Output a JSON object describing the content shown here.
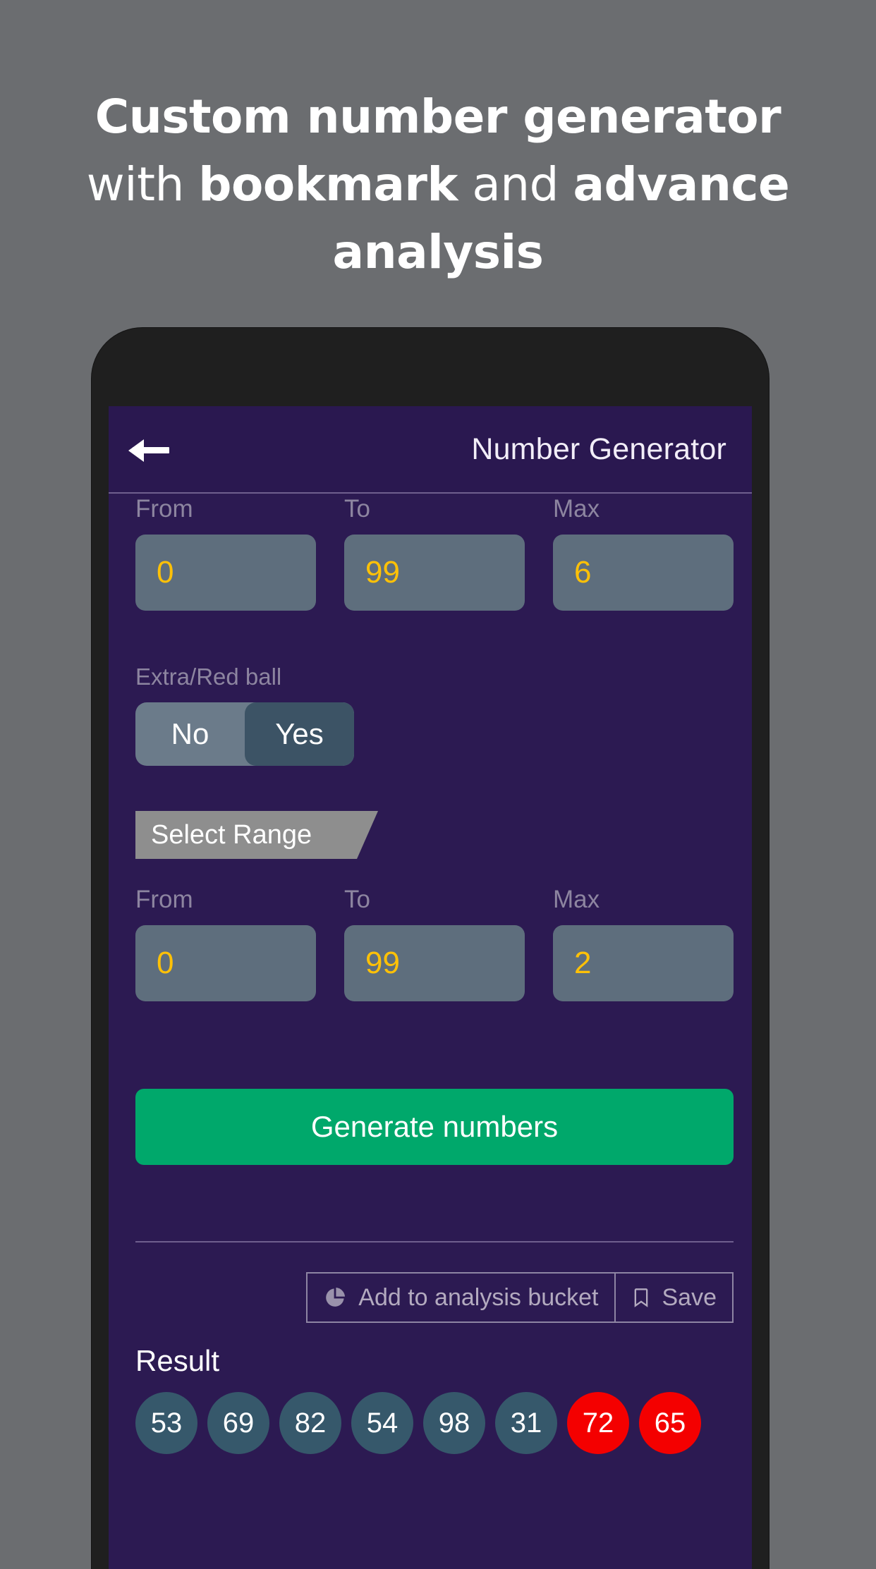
{
  "promo": {
    "line1_bold": "Custom number generator",
    "line2_prefix": "with ",
    "line2_bold1": "bookmark",
    "line2_mid": " and ",
    "line2_bold2": "advance",
    "line3_bold": "analysis"
  },
  "appbar": {
    "back_icon": "back-arrow-icon",
    "title": "Number Generator"
  },
  "primary_range": {
    "from_label": "From",
    "from_value": "0",
    "to_label": "To",
    "to_value": "99",
    "max_label": "Max",
    "max_value": "6"
  },
  "extra_ball": {
    "label": "Extra/Red ball",
    "option_no": "No",
    "option_yes": "Yes",
    "selected": "Yes"
  },
  "select_range": {
    "ribbon_label": "Select Range"
  },
  "secondary_range": {
    "from_label": "From",
    "from_value": "0",
    "to_label": "To",
    "to_value": "99",
    "max_label": "Max",
    "max_value": "2"
  },
  "generate": {
    "label": "Generate numbers"
  },
  "actions": {
    "analysis_label": "Add to analysis bucket",
    "analysis_icon": "pie-chart-icon",
    "save_label": "Save",
    "save_icon": "bookmark-icon"
  },
  "result": {
    "label": "Result",
    "balls": [
      {
        "value": "53",
        "type": "normal"
      },
      {
        "value": "69",
        "type": "normal"
      },
      {
        "value": "82",
        "type": "normal"
      },
      {
        "value": "54",
        "type": "normal"
      },
      {
        "value": "98",
        "type": "normal"
      },
      {
        "value": "31",
        "type": "normal"
      },
      {
        "value": "72",
        "type": "extra"
      },
      {
        "value": "65",
        "type": "extra"
      }
    ]
  },
  "colors": {
    "page_background": "#6b6d70",
    "phone_frame": "#1f1f1f",
    "screen_background": "#2c1a52",
    "appbar_background": "#2a1850",
    "input_background": "#5e6e7d",
    "input_text": "#ffc107",
    "toggle_track": "#6b7b8a",
    "toggle_active": "#3c5365",
    "ribbon": "#8e8e8e",
    "generate_button": "#00a86b",
    "ball_normal": "#36586b",
    "ball_extra": "#f40000",
    "label_muted": "#8d85a0"
  }
}
